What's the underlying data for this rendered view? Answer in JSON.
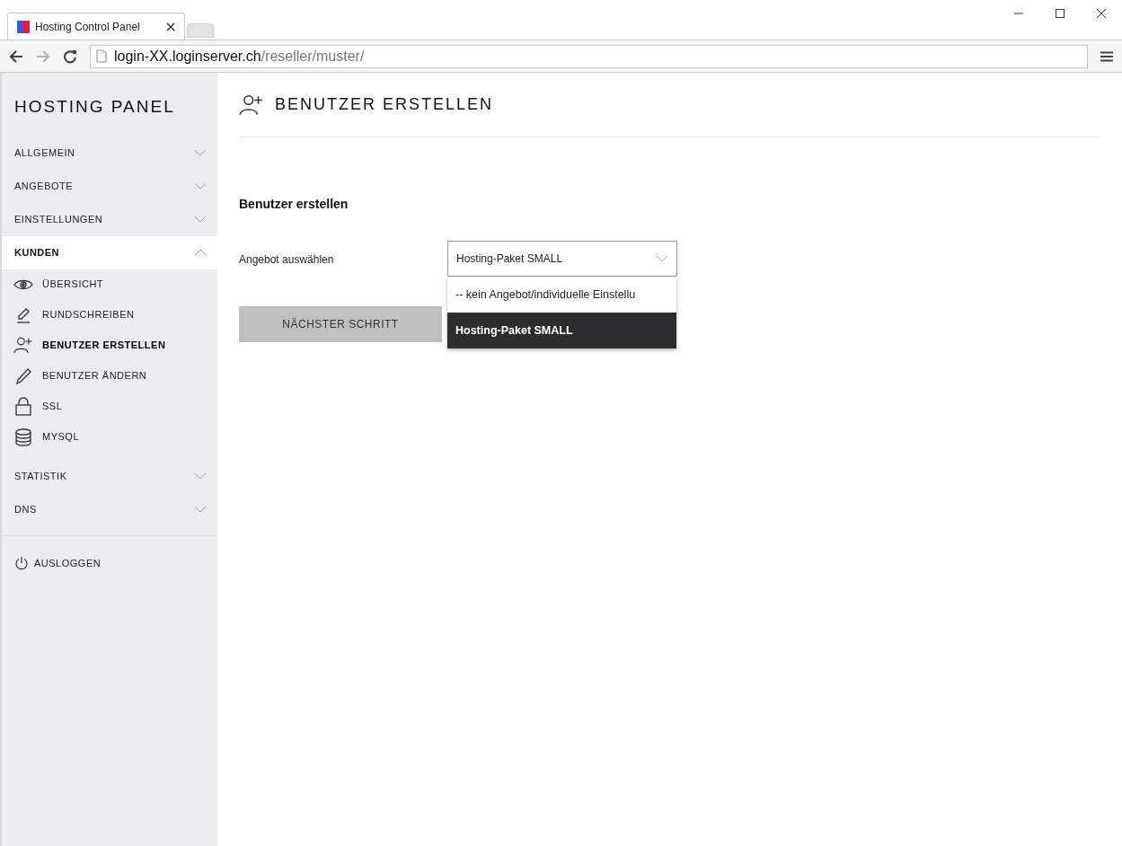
{
  "browser": {
    "tab_title": "Hosting Control Panel",
    "url_host": "login-XX.loginserver.ch",
    "url_path": "/reseller/muster/"
  },
  "sidebar": {
    "brand": "HOSTING PANEL",
    "sections": [
      {
        "label": "ALLGEMEIN",
        "expanded": false
      },
      {
        "label": "ANGEBOTE",
        "expanded": false
      },
      {
        "label": "EINSTELLUNGEN",
        "expanded": false
      },
      {
        "label": "KUNDEN",
        "expanded": true,
        "children": [
          {
            "label": "ÜBERSICHT",
            "selected": false
          },
          {
            "label": "RUNDSCHREIBEN",
            "selected": false
          },
          {
            "label": "BENUTZER ERSTELLEN",
            "selected": true
          },
          {
            "label": "BENUTZER ÄNDERN",
            "selected": false
          },
          {
            "label": "SSL",
            "selected": false
          },
          {
            "label": "MYSQL",
            "selected": false
          }
        ]
      },
      {
        "label": "STATISTIK",
        "expanded": false
      },
      {
        "label": "DNS",
        "expanded": false
      }
    ],
    "logout": "AUSLOGGEN"
  },
  "page": {
    "title": "BENUTZER ERSTELLEN",
    "section_title": "Benutzer erstellen",
    "field_label": "Angebot auswählen",
    "select": {
      "value": "Hosting-Paket SMALL",
      "expanded": true,
      "options": [
        {
          "label": "-- kein Angebot/individuelle Einstellu",
          "selected": false
        },
        {
          "label": "Hosting-Paket SMALL",
          "selected": true
        }
      ]
    },
    "next_button": "NÄCHSTER SCHRITT"
  }
}
